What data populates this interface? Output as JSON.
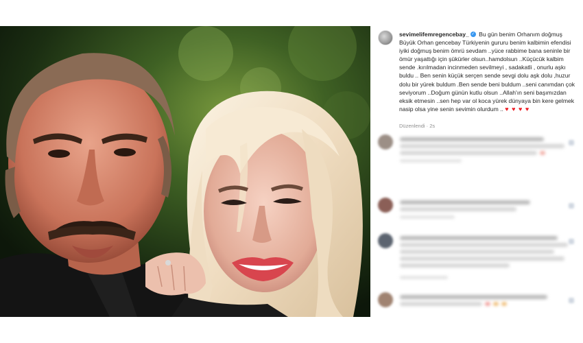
{
  "post": {
    "username": "sevimelifemregencebay_",
    "caption": "Bu gün benim Orhanım doğmuş Büyük Orhan gencebay Türkiyenin gururu benim kalbimin efendisi iyiki doğmuş benim ömrü sevdam ..yüce rabbime bana seninle bir ömür yaşattığı için şükürler olsun..hamdolsun ..Küçücük kalbim sende .kırılmadan incinmeden sevilmeyi , sadakatli , onurlu aşkı buldu .. Ben senin küçük serçen sende sevgi dolu aşk dolu ,huzur dolu bir yürek buldum .Ben sende beni buldum ..seni canımdan çok seviyorum ..Doğum günün kutlu olsun ..Allah'ın seni başımızdan eksik etmesin ..sen hep var ol koca yürek dünyaya bin kere gelmek nasip olsa yine senin sevimin olurdum ..",
    "hearts": "♥ ♥ ♥ ♥",
    "edited_label": "Düzenlendi · 2s",
    "verified_icon": "✓"
  },
  "colors": {
    "verified": "#3897f0",
    "heart": "#ed1c24",
    "meta_text": "#8e8e8e"
  }
}
